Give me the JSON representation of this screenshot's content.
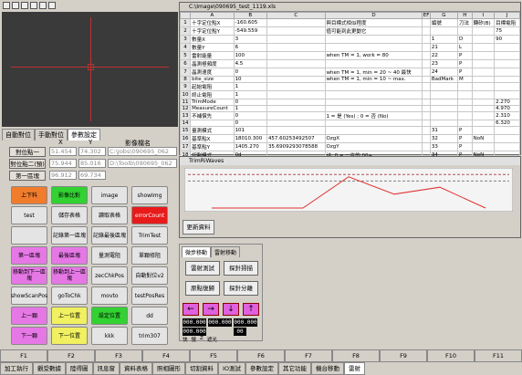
{
  "camera_tabs": [
    "自動對位",
    "手動對位",
    "參數設定"
  ],
  "position": {
    "col_x": "X",
    "col_y": "Y",
    "col_name": "影像檔名",
    "rows": [
      {
        "label": "對位點一",
        "x": "51.454",
        "y": "74.302",
        "file": "C:\\Jobs\\090695_062"
      },
      {
        "label": "對位點二(預)",
        "x": "75.944",
        "y": "85.016",
        "file": "D:\\Toolb\\090695_062"
      },
      {
        "label": "第一區塊",
        "x": "96.912",
        "y": "69.734",
        "file": ""
      }
    ]
  },
  "grid_buttons": [
    [
      "上下料",
      "影像比對",
      "image",
      "showImg"
    ],
    [
      "test",
      "儲存表格",
      "讀取表格",
      "errorCount"
    ],
    [
      "",
      "記錄第一區塊",
      "記錄最後區塊",
      "TrimTest"
    ],
    [
      "第一區塊",
      "最後區塊",
      "量測電阻",
      "單顆修阻"
    ],
    [
      "移動到下一區塊",
      "移動到上一區塊",
      "zecChkPos",
      "自動對位v2"
    ],
    [
      "showScanPos",
      "goToChk",
      "movto",
      "testPosRes"
    ],
    [
      "上一顆",
      "上一位置",
      "設定位置",
      "dd"
    ],
    [
      "下一顆",
      "下一位置",
      "kkk",
      "trim307"
    ]
  ],
  "spreadsheet": {
    "title": "C:\\Image\\090695_test_1119.xls",
    "columns": [
      "",
      "A",
      "B",
      "C",
      "D",
      "EF",
      "G",
      "H",
      "I",
      "J"
    ],
    "rows": [
      [
        "1",
        "十字定位點X",
        "-160.605",
        "",
        "與目標式相似程度",
        "",
        "編號",
        "刀法",
        "轉矽(B)",
        "目標電阻"
      ],
      [
        "2",
        "十字定位點Y",
        "-549.559",
        "",
        "值可能到此更動它",
        "",
        "",
        "",
        "",
        "75"
      ],
      [
        "3",
        "數量X",
        "3",
        "",
        "",
        "",
        "1",
        "D",
        "",
        "90"
      ],
      [
        "4",
        "數量Y",
        "6",
        "",
        "",
        "",
        "21",
        "L",
        "",
        ""
      ],
      [
        "5",
        "雷射能量",
        "100",
        "",
        "when TM = 1, work = 80",
        "",
        "22",
        "P",
        "",
        ""
      ],
      [
        "6",
        "晶測極頻度",
        "4.5",
        "",
        "",
        "",
        "23",
        "P",
        "",
        ""
      ],
      [
        "7",
        "晶測速度",
        "0",
        "",
        "when TM = 1, min = 20 ~ 40 最快",
        "",
        "24",
        "P",
        "",
        ""
      ],
      [
        "8",
        "bite_size",
        "10",
        "",
        "when TM = 1, min = 10 ~ max.",
        "",
        "BadMark",
        "M",
        "",
        ""
      ],
      [
        "9",
        "起始電阻",
        "1",
        "",
        "",
        "",
        "",
        "",
        "",
        ""
      ],
      [
        "10",
        "終止電阻",
        "1",
        "",
        "",
        "",
        "",
        "",
        "",
        ""
      ],
      [
        "11",
        "TrimMode",
        "0",
        "",
        "",
        "",
        "",
        "",
        "",
        "2.270"
      ],
      [
        "12",
        "MeasureCount",
        "1",
        "",
        "",
        "",
        "",
        "",
        "",
        "4.970"
      ],
      [
        "13",
        "不補償先",
        "0",
        "",
        "1 = 是 (Yes) ; 0 = 否 (No)",
        "",
        "",
        "",
        "",
        "2.310"
      ],
      [
        "14",
        "",
        "0",
        "",
        "",
        "",
        "",
        "",
        "",
        "6.320"
      ],
      [
        "15",
        "量測模式",
        "101",
        "",
        "",
        "",
        "31",
        "P",
        "",
        ""
      ],
      [
        "16",
        "基準點X",
        "18010.300",
        "457.60253492507",
        "OzgX",
        "",
        "32",
        "P",
        "NoN",
        ""
      ],
      [
        "17",
        "基準點Y",
        "1405.270",
        "35.6909293078588",
        "OzgY",
        "",
        "33",
        "P",
        "",
        ""
      ],
      [
        "18",
        "切割模式",
        "0d",
        "",
        "註: 0 = 一片的 00+",
        "",
        "34",
        "P",
        "NoN",
        ""
      ]
    ]
  },
  "wave": {
    "title": "TrimRiWaves",
    "update_button": "更新資料",
    "chart_data": {
      "type": "line",
      "x": [
        0,
        1,
        2,
        3,
        4,
        5,
        6
      ],
      "values": [
        0,
        0,
        0,
        90,
        40,
        60,
        0
      ],
      "ylim": [
        0,
        100
      ]
    }
  },
  "motion": {
    "tabs": [
      "微步移動",
      "雷射移動"
    ],
    "buttons": [
      "雷射測試",
      "探針掃描",
      "原點復歸",
      "探針分離"
    ],
    "arrows": [
      "←",
      "→",
      "↓",
      "↑"
    ],
    "digits": [
      "000.000",
      "000.000",
      "000.000",
      "000.000",
      "00"
    ],
    "radio_labels": [
      "快",
      "慢",
      "Z",
      "遮光"
    ]
  },
  "fkeys": [
    "F1",
    "F2",
    "F3",
    "F4",
    "F5",
    "F6",
    "F7",
    "F8",
    "F9",
    "F10",
    "F11"
  ],
  "bottom_tabs": [
    "加工執行",
    "觀受數據",
    "陸得圖",
    "訊息窗",
    "資料表格",
    "照相圖形",
    "切割資料",
    "IO測試",
    "參數設定",
    "其它功能",
    "機台移動",
    "雷射"
  ]
}
